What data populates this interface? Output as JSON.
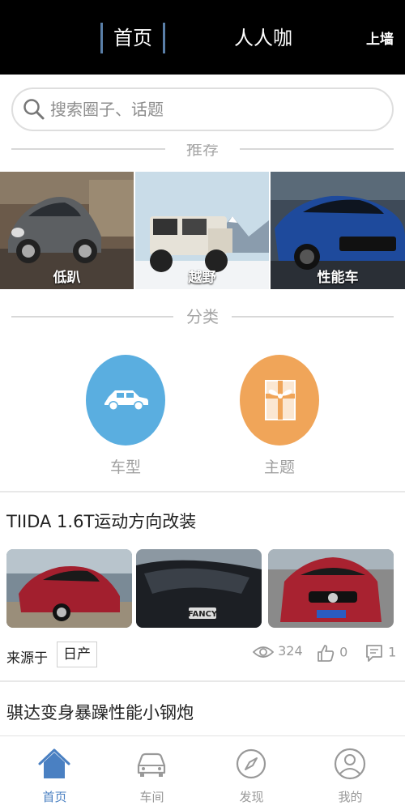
{
  "header": {
    "tab_home": "首页",
    "tab_app": "人人咖",
    "right_action": "上墙"
  },
  "search": {
    "placeholder": "搜索圈子、话题"
  },
  "recommend": {
    "section_label": "推荐",
    "tiles": [
      {
        "label": "低趴"
      },
      {
        "label": "越野"
      },
      {
        "label": "性能车"
      }
    ]
  },
  "categories": {
    "section_label": "分类",
    "items": [
      {
        "label": "车型",
        "color": "#5aaee0",
        "icon": "car-icon"
      },
      {
        "label": "主题",
        "color": "#f0a559",
        "icon": "gift-icon"
      }
    ]
  },
  "feed": {
    "posts": [
      {
        "title": "TIIDA 1.6T运动方向改装",
        "source_label": "来源于",
        "brand": "日产",
        "views": "324",
        "likes": "0",
        "comments": "1"
      },
      {
        "title": "骐达变身暴躁性能小钢炮"
      }
    ]
  },
  "tabbar": {
    "items": [
      {
        "label": "首页",
        "icon": "home-icon",
        "active": true
      },
      {
        "label": "车间",
        "icon": "car-front-icon",
        "active": false
      },
      {
        "label": "发现",
        "icon": "compass-icon",
        "active": false
      },
      {
        "label": "我的",
        "icon": "user-icon",
        "active": false
      }
    ]
  },
  "colors": {
    "accent": "#4a80c2",
    "header_bg": "#000000",
    "category_blue": "#5aaee0",
    "category_orange": "#f0a559"
  }
}
